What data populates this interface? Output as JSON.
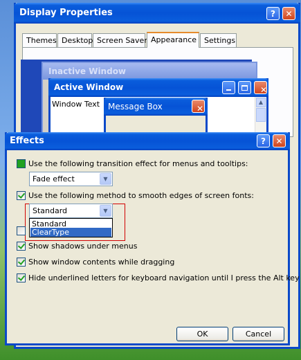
{
  "display_properties": {
    "title": "Display Properties",
    "help_glyph": "?",
    "close_glyph": "✕",
    "tabs": [
      {
        "label": "Themes"
      },
      {
        "label": "Desktop"
      },
      {
        "label": "Screen Saver"
      },
      {
        "label": "Appearance"
      },
      {
        "label": "Settings"
      }
    ],
    "active_tab": "Appearance",
    "preview": {
      "inactive_window_title": "Inactive Window",
      "active_window_title": "Active Window",
      "window_text": "Window Text",
      "message_box_title": "Message Box"
    }
  },
  "effects_dialog": {
    "title": "Effects",
    "help_glyph": "?",
    "close_glyph": "✕",
    "options": {
      "transition": {
        "label": "Use the following transition effect for menus and tooltips:",
        "checked": true
      },
      "transition_select": {
        "value": "Fade effect"
      },
      "smooth_fonts": {
        "label": "Use the following method to smooth edges of screen fonts:",
        "checked": true
      },
      "smooth_select": {
        "value": "Standard",
        "options": [
          "Standard",
          "ClearType"
        ],
        "highlighted": "ClearType"
      },
      "shadows": {
        "label": "Show shadows under menus",
        "checked": true
      },
      "window_contents": {
        "label": "Show window contents while dragging",
        "checked": true
      },
      "hide_underlines": {
        "label": "Hide underlined letters for keyboard navigation until I press the Alt key",
        "checked": true
      }
    },
    "ok_label": "OK",
    "cancel_label": "Cancel"
  },
  "colors": {
    "title_blue": "#0653d6",
    "highlight_blue": "#316ac5",
    "annotation_red": "#d20000",
    "dialog_bg": "#ece9d8"
  }
}
